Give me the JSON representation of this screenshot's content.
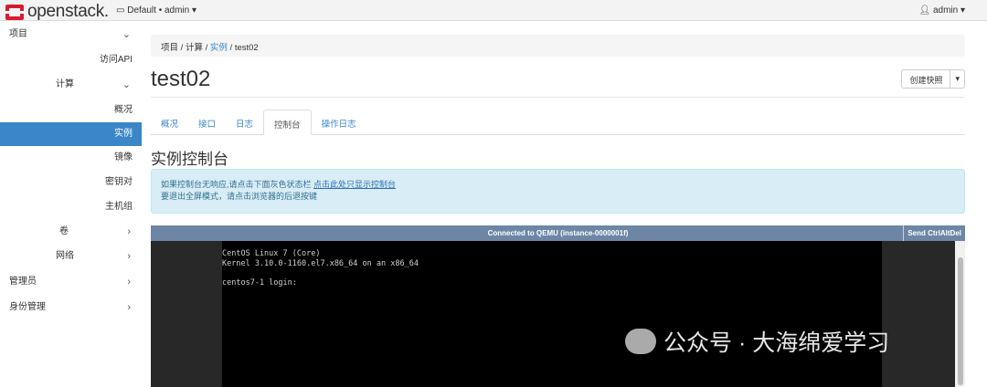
{
  "topbar": {
    "brand": "openstack.",
    "project": "Default • admin ▾",
    "user": "admin ▾"
  },
  "sidebar": [
    {
      "label": "项目",
      "chev": "⌄"
    },
    {
      "label": "访问API"
    },
    {
      "label": "计算",
      "chev": "⌄"
    },
    {
      "label": "概况"
    },
    {
      "label": "实例"
    },
    {
      "label": "镜像"
    },
    {
      "label": "密钥对"
    },
    {
      "label": "主机组"
    },
    {
      "label": "卷",
      "chev": "›"
    },
    {
      "label": "网络",
      "chev": "›"
    },
    {
      "label": "管理员",
      "chev": "›"
    },
    {
      "label": "身份管理",
      "chev": "›"
    }
  ],
  "breadcrumb": [
    "项目",
    "计算",
    "实例",
    "test02"
  ],
  "page_title": "test02",
  "snapshot_button": "创建快照",
  "tabs": [
    "概况",
    "接口",
    "日志",
    "控制台",
    "操作日志"
  ],
  "section_title": "实例控制台",
  "alert": {
    "line1": "如果控制台无响应,请点击下面灰色状态栏",
    "link": "点击此处只显示控制台",
    "line2": "要退出全屏模式，请点击浏览器的后退按键"
  },
  "console": {
    "status": "Connected to QEMU (instance-0000001f)",
    "send_button": "Send CtrlAltDel",
    "output": "CentOS Linux 7 (Core)\nKernel 3.10.0-1160.el7.x86_64 on an x86_64\n\ncentos7-1 login: "
  },
  "watermark": "公众号 · 大海绵爱学习"
}
